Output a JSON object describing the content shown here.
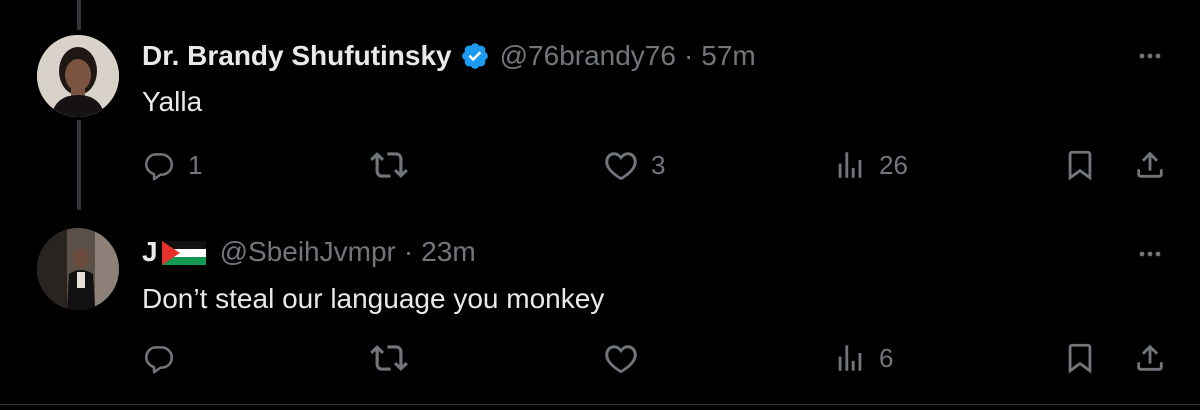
{
  "tweets": [
    {
      "name": "Dr. Brandy Shufutinsky",
      "verified": true,
      "handle": "@76brandy76",
      "separator": "·",
      "time": "57m",
      "text": "Yalla",
      "replies": "1",
      "retweets": "",
      "likes": "3",
      "views": "26"
    },
    {
      "name": "J",
      "verified": false,
      "handle": "@SbeihJvmpr",
      "separator": "·",
      "time": "23m",
      "text": "Don’t steal our language you monkey",
      "replies": "",
      "retweets": "",
      "likes": "",
      "views": "6"
    }
  ],
  "icons": {
    "more": "more-horizontal-icon",
    "reply": "reply-icon",
    "retweet": "retweet-icon",
    "like": "heart-icon",
    "views": "views-chart-icon",
    "bookmark": "bookmark-icon",
    "share": "share-icon",
    "verified": "verified-badge-icon",
    "flag": "palestine-flag-icon"
  },
  "colors": {
    "background": "#000000",
    "primary_text": "#e7e9ea",
    "secondary_text": "#71767b",
    "verified_blue": "#1d9bf0",
    "thread_line": "#333639"
  }
}
